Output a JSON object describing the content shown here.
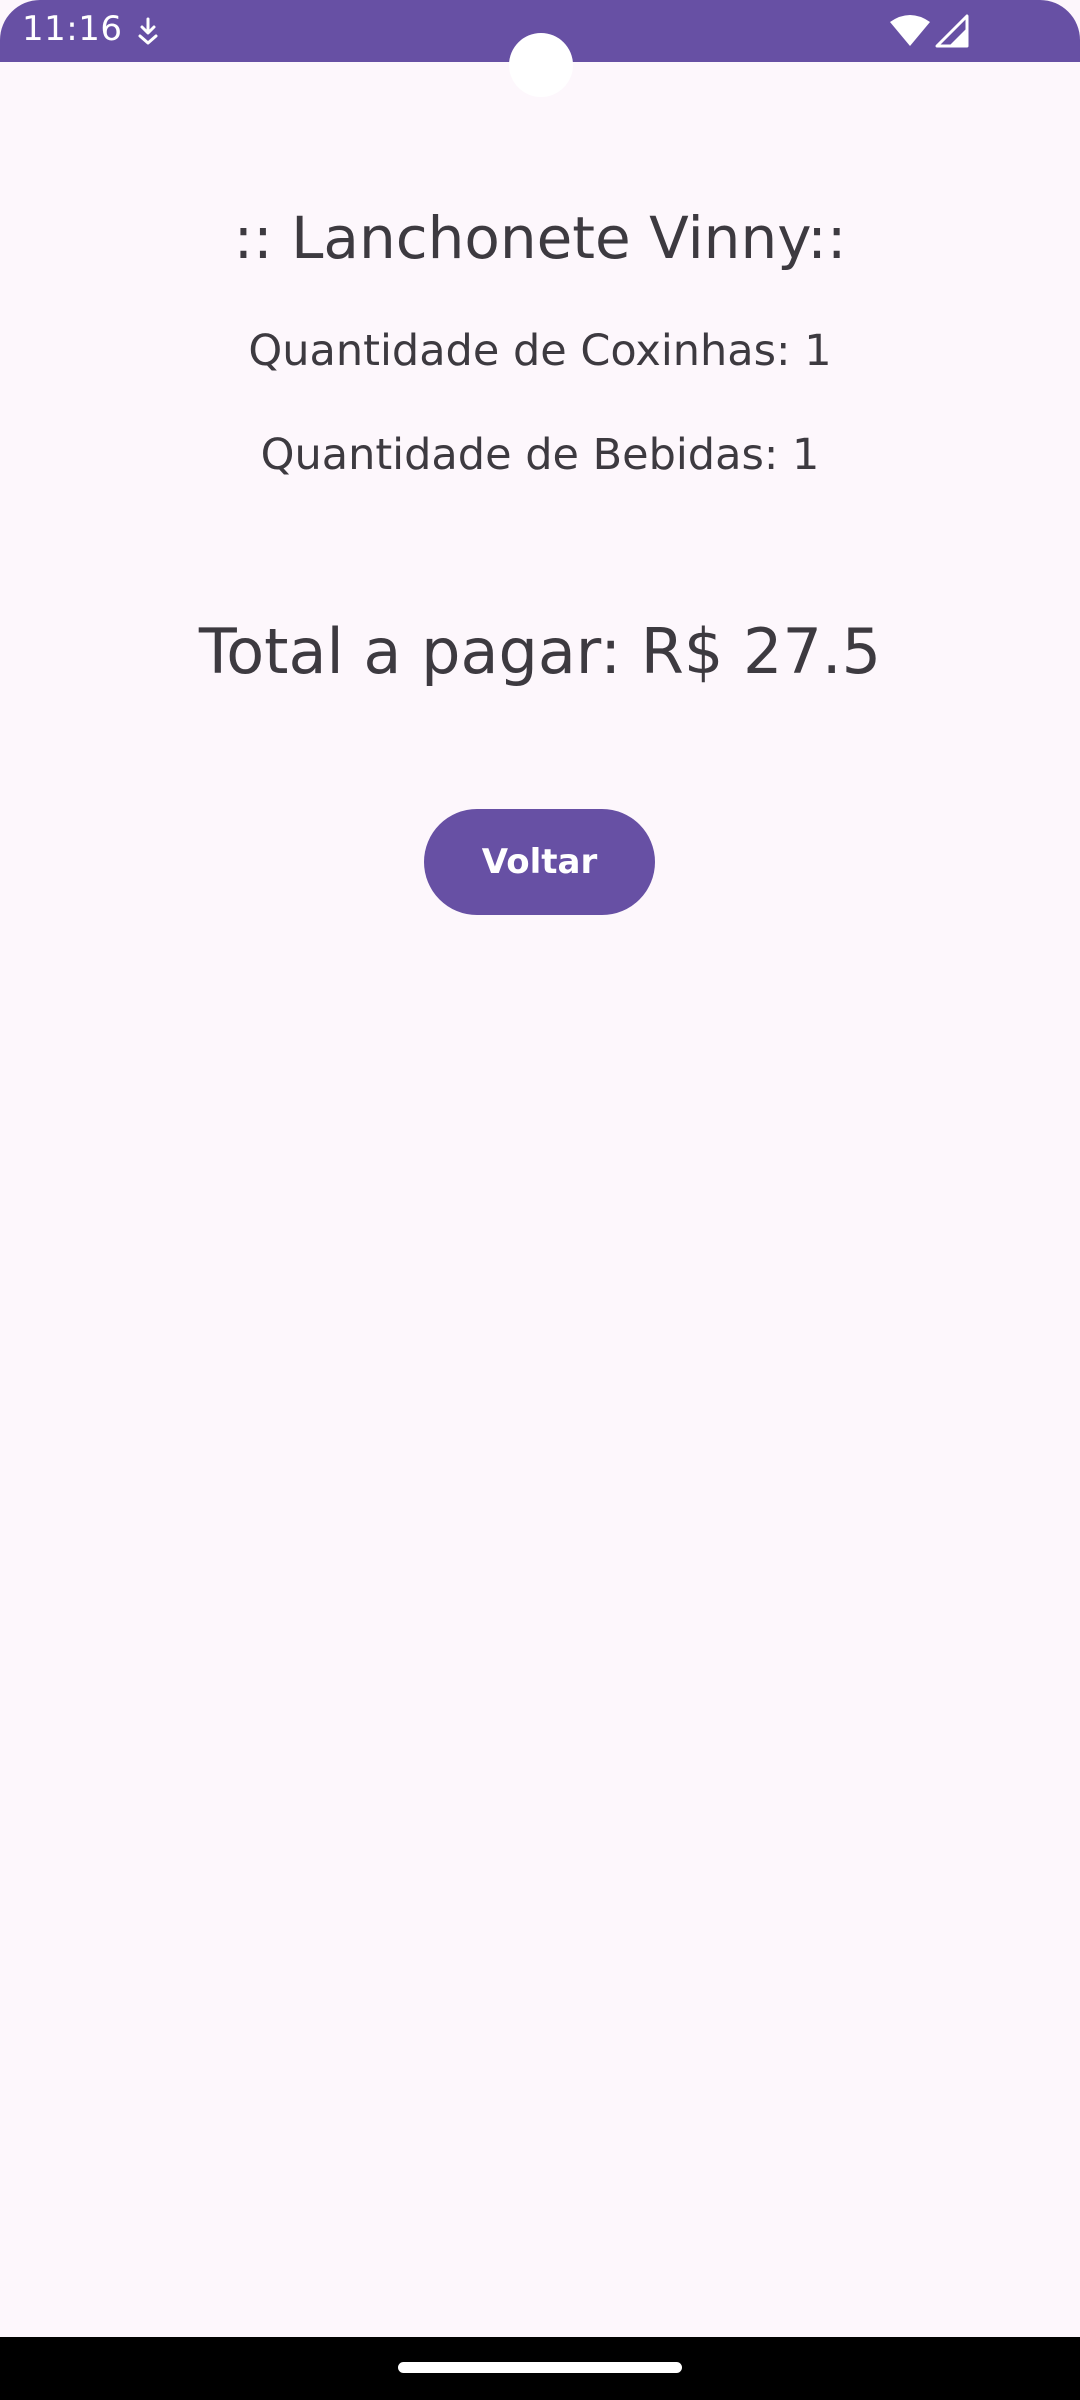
{
  "status_bar": {
    "time": "11:16",
    "background_color": "#6750a4",
    "icons": [
      "download-notification-icon",
      "wifi-icon",
      "cell-signal-icon"
    ]
  },
  "app": {
    "title": ":: Lanchonete Vinny::",
    "coxinhas_label": "Quantidade de Coxinhas: 1",
    "bebidas_label": "Quantidade de Bebidas: 1",
    "total_label": "Total a pagar: R$ 27.5",
    "back_button_label": "Voltar",
    "accent_color": "#6750a4",
    "background_color": "#fdf7fc",
    "text_color": "#3d3a40"
  },
  "navigation": {
    "home_handle": "home-gesture-handle"
  }
}
